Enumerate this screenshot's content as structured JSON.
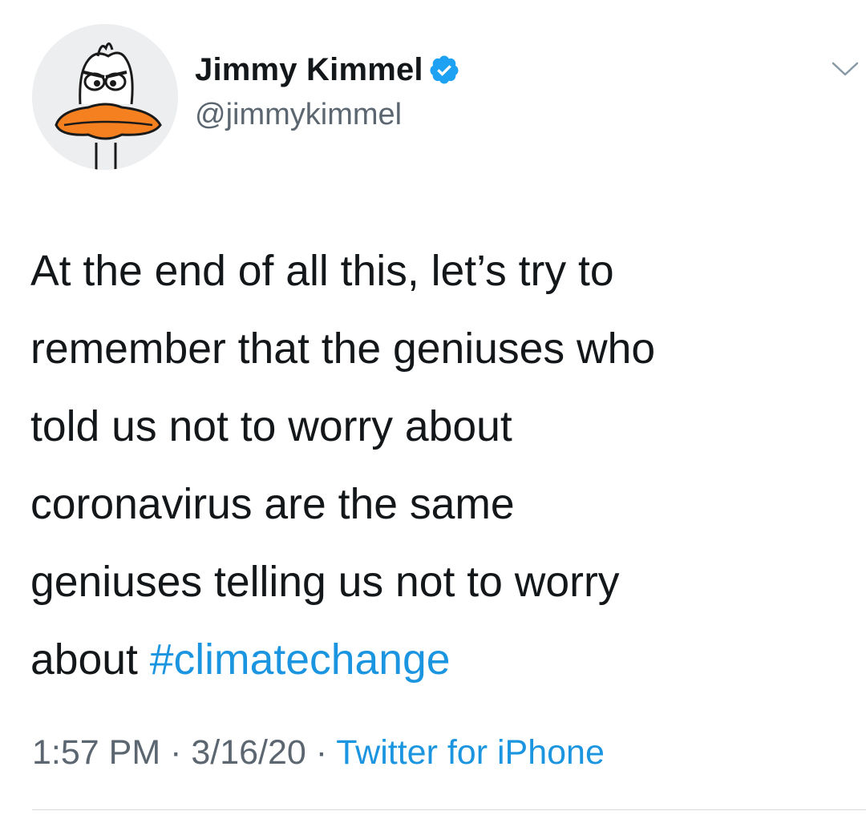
{
  "author": {
    "display_name": "Jimmy Kimmel",
    "handle": "@jimmykimmel",
    "verified": true,
    "avatar_icon": "duck-cartoon-avatar"
  },
  "tweet": {
    "lines": [
      "At the end of all this, let’s try to",
      "remember that the geniuses who",
      "told us not to worry about",
      "coronavirus are the same",
      "geniuses telling us not to worry",
      "about "
    ],
    "hashtag": "#climatechange"
  },
  "meta": {
    "time": "1:57 PM",
    "separator_1": " · ",
    "date": "3/16/20",
    "separator_2": " · ",
    "source": "Twitter for iPhone"
  },
  "colors": {
    "link": "#1b95e0",
    "text": "#14171a",
    "secondary": "#5b6670",
    "verified_badge": "#1da1f2"
  }
}
